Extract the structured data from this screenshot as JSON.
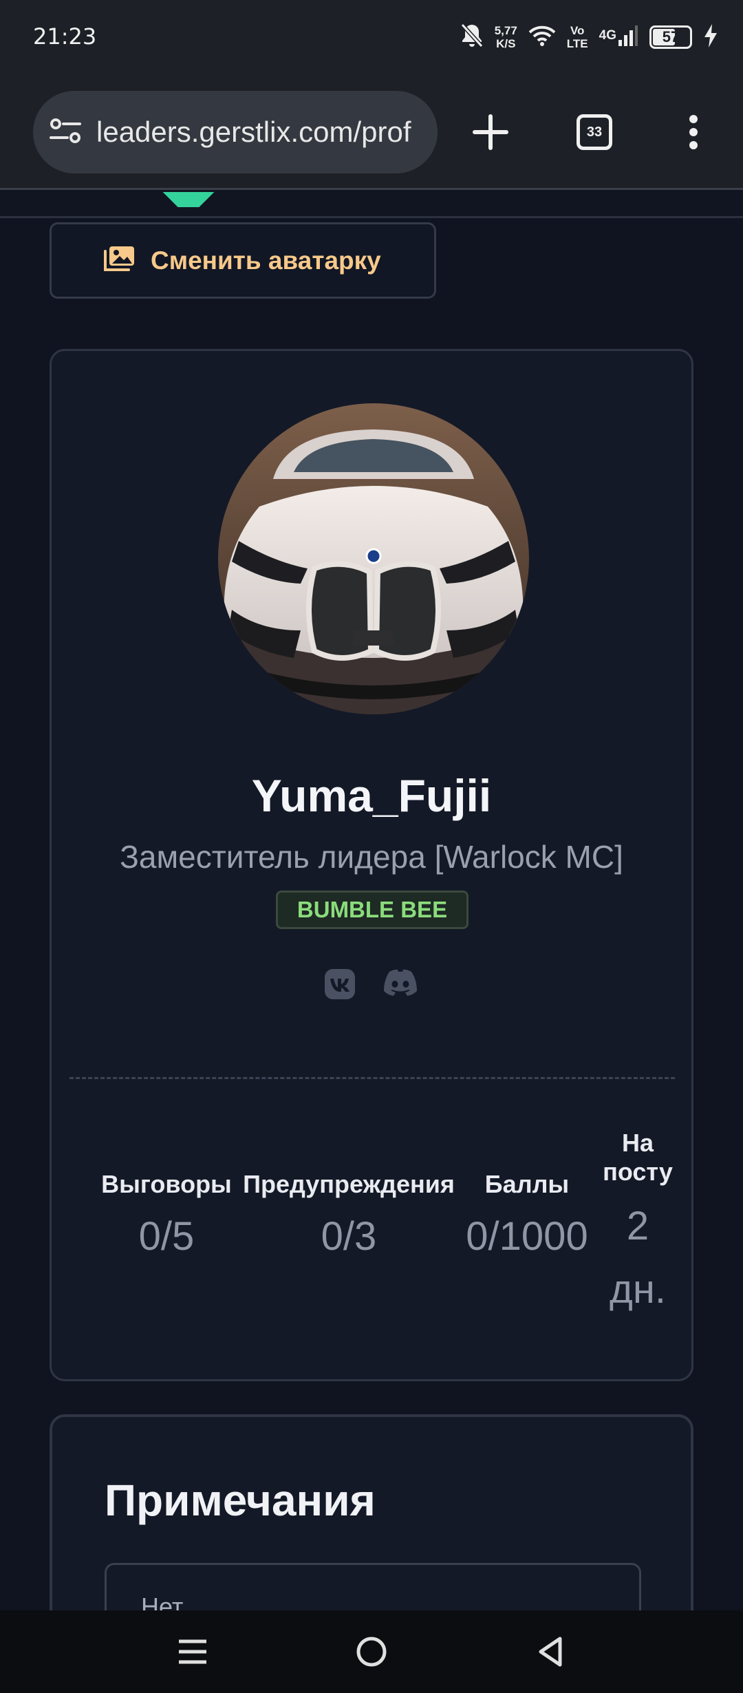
{
  "status_bar": {
    "time": "21:23",
    "net_speed_value": "5,77",
    "net_speed_unit": "K/S",
    "volte_top": "Vo",
    "volte_bottom": "LTE",
    "network": "4G",
    "battery": "57",
    "battery_level": 0.57
  },
  "browser": {
    "url": "leaders.gerstlix.com/prof",
    "tab_count": "33"
  },
  "avatar_button": {
    "label": "Сменить аватарку"
  },
  "profile": {
    "username": "Yuma_Fujii",
    "role": "Заместитель лидера [Warlock MC]",
    "badge": "BUMBLE BEE",
    "badge_color": "#8bdc7c",
    "social_icons": [
      "vk-icon",
      "discord-icon"
    ]
  },
  "stats": {
    "reprimands": {
      "label": "Выговоры",
      "value": "0/5"
    },
    "warnings": {
      "label": "Предупреждения",
      "value": "0/3"
    },
    "points": {
      "label": "Баллы",
      "value": "0/1000"
    },
    "tenure": {
      "label_line1": "На",
      "label_line2": "посту",
      "value_line1": "2",
      "value_line2": "дн."
    }
  },
  "notes": {
    "title": "Примечания",
    "text": "Нет"
  },
  "colors": {
    "background": "#101420",
    "accent": "#f7c98a",
    "brand": "#35d39c"
  }
}
